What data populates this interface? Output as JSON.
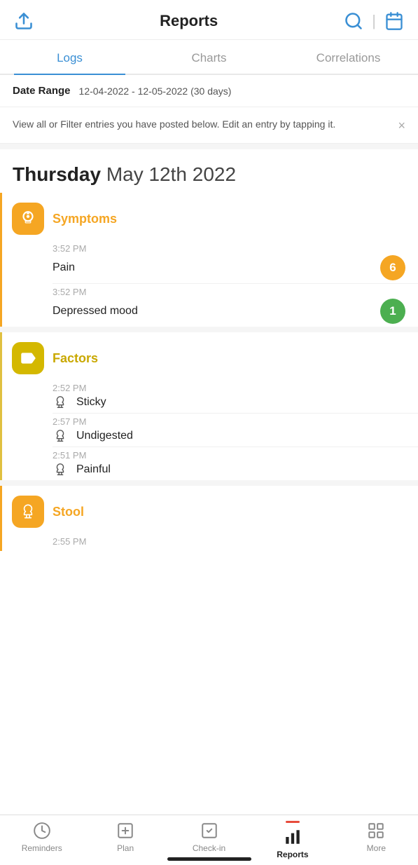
{
  "header": {
    "title": "Reports",
    "upload_icon": "upload-icon",
    "search_icon": "search-icon",
    "calendar_icon": "calendar-icon"
  },
  "tabs": [
    {
      "id": "logs",
      "label": "Logs",
      "active": true
    },
    {
      "id": "charts",
      "label": "Charts",
      "active": false
    },
    {
      "id": "correlations",
      "label": "Correlations",
      "active": false
    }
  ],
  "date_range": {
    "label": "Date Range",
    "value": "12-04-2022 - 12-05-2022 (30 days)"
  },
  "info_banner": {
    "text": "View all or Filter entries you have posted below. Edit an entry by tapping it.",
    "close_label": "×"
  },
  "day": {
    "name": "Thursday",
    "date": "May 12th 2022"
  },
  "sections": [
    {
      "id": "symptoms",
      "title": "Symptoms",
      "icon_type": "symptoms",
      "entries": [
        {
          "time": "3:52 PM",
          "name": "Pain",
          "badge": "6",
          "badge_color": "orange",
          "has_icon": false
        },
        {
          "time": "3:52 PM",
          "name": "Depressed mood",
          "badge": "1",
          "badge_color": "green",
          "has_icon": false
        }
      ]
    },
    {
      "id": "factors",
      "title": "Factors",
      "icon_type": "factors",
      "entries": [
        {
          "time": "2:52 PM",
          "name": "Sticky",
          "badge": "",
          "badge_color": "",
          "has_icon": true
        },
        {
          "time": "2:57 PM",
          "name": "Undigested",
          "badge": "",
          "badge_color": "",
          "has_icon": true
        },
        {
          "time": "2:51 PM",
          "name": "Painful",
          "badge": "",
          "badge_color": "",
          "has_icon": true
        }
      ]
    },
    {
      "id": "stool",
      "title": "Stool",
      "icon_type": "stool",
      "entries": [
        {
          "time": "2:55 PM",
          "name": "",
          "badge": "",
          "badge_color": "",
          "has_icon": false
        }
      ]
    }
  ],
  "bottom_nav": [
    {
      "id": "reminders",
      "label": "Reminders",
      "active": false
    },
    {
      "id": "plan",
      "label": "Plan",
      "active": false
    },
    {
      "id": "checkin",
      "label": "Check-in",
      "active": false
    },
    {
      "id": "reports",
      "label": "Reports",
      "active": true
    },
    {
      "id": "more",
      "label": "More",
      "active": false
    }
  ]
}
